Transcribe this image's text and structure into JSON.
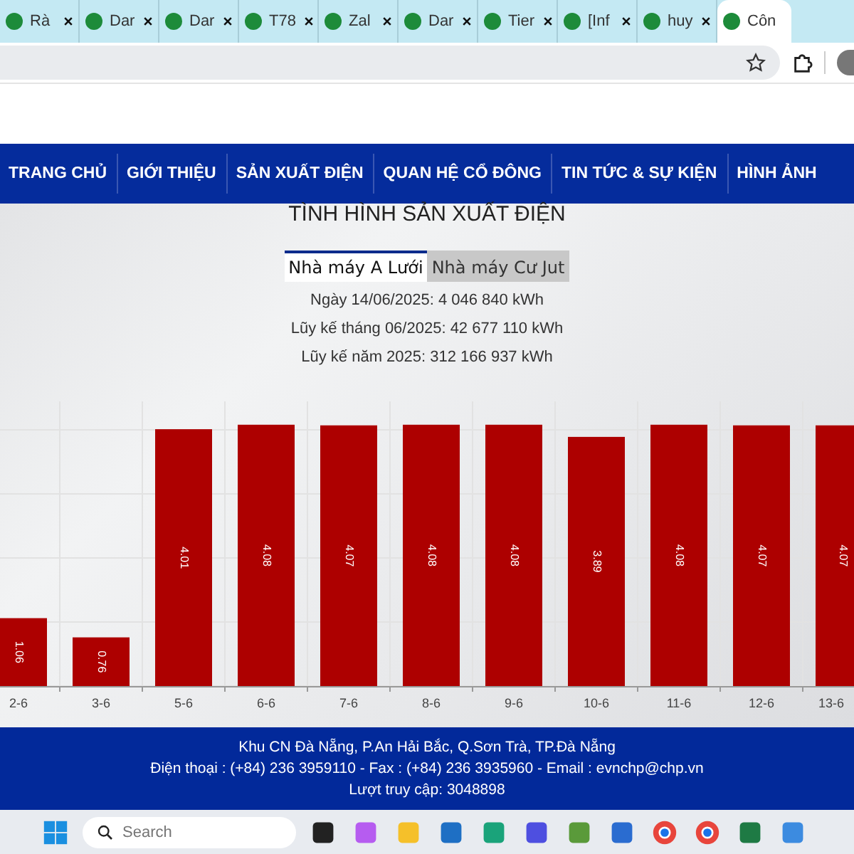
{
  "browser": {
    "tabs": [
      {
        "title": "Rà",
        "selected": false
      },
      {
        "title": "Dar",
        "selected": false
      },
      {
        "title": "Dar",
        "selected": false
      },
      {
        "title": "T78",
        "selected": false
      },
      {
        "title": "Zal",
        "selected": false
      },
      {
        "title": "Dar",
        "selected": false
      },
      {
        "title": "Tier",
        "selected": false
      },
      {
        "title": "[Inf",
        "selected": false
      },
      {
        "title": "huy",
        "selected": false
      },
      {
        "title": "Côn",
        "selected": true
      }
    ]
  },
  "nav": {
    "items": [
      {
        "label": "TRANG CHỦ"
      },
      {
        "label": "GIỚI THIỆU"
      },
      {
        "label": "SẢN XUẤT ĐIỆN"
      },
      {
        "label": "QUAN HỆ CỔ ĐÔNG"
      },
      {
        "label": "TIN TỨC & SỰ KIỆN"
      },
      {
        "label": "HÌNH ẢNH"
      }
    ]
  },
  "production": {
    "title": "TÌNH HÌNH SẢN XUẤT ĐIỆN",
    "tabs": [
      {
        "label": "Nhà máy A Lưới",
        "selected": true
      },
      {
        "label": "Nhà máy Cư Jut",
        "selected": false
      }
    ],
    "stats": [
      "Ngày 14/06/2025: 4 046 840 kWh",
      "Lũy kế tháng 06/2025: 42 677 110 kWh",
      "Lũy kế năm 2025: 312 166 937 kWh"
    ],
    "chart_data": {
      "type": "bar",
      "categories": [
        "2-6",
        "3-6",
        "5-6",
        "6-6",
        "7-6",
        "8-6",
        "9-6",
        "10-6",
        "11-6",
        "12-6",
        "13-6"
      ],
      "series": [
        {
          "color": "#ad0000",
          "values": [
            1.06,
            0.76,
            4.01,
            4.08,
            4.07,
            4.08,
            4.08,
            3.89,
            4.08,
            4.07,
            4.07
          ]
        }
      ],
      "data_labels": true
    }
  },
  "footer": {
    "lines": [
      "Khu CN Đà Nẵng, P.An Hải Bắc, Q.Sơn Trà, TP.Đà Nẵng",
      "Điện thoại : (+84) 236 3959110 - Fax : (+84) 236 3935960 - Email : evnchp@chp.vn",
      "Lượt truy cập: 3048898"
    ]
  },
  "taskbar": {
    "search": {
      "placeholder": "Search"
    }
  }
}
